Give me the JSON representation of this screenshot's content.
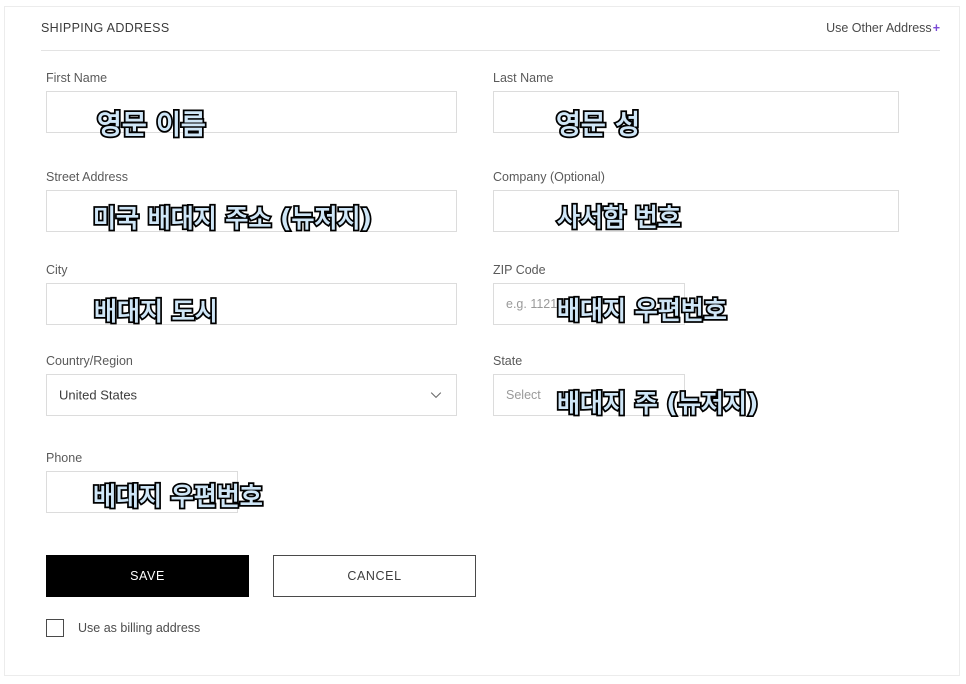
{
  "section": {
    "title": "SHIPPING ADDRESS",
    "use_other_address": "Use Other Address",
    "use_other_plus": "+",
    "accent_plus_color": "#7b4bd6"
  },
  "fields": {
    "first_name": {
      "label": "First Name",
      "value": "",
      "placeholder": ""
    },
    "last_name": {
      "label": "Last Name",
      "value": "",
      "placeholder": ""
    },
    "street": {
      "label": "Street Address",
      "value": "",
      "placeholder": ""
    },
    "company": {
      "label": "Company (Optional)",
      "value": "",
      "placeholder": ""
    },
    "city": {
      "label": "City",
      "value": "",
      "placeholder": ""
    },
    "zip": {
      "label": "ZIP Code",
      "value": "",
      "placeholder": "e.g. 11215"
    },
    "country": {
      "label": "Country/Region",
      "value": "United States",
      "placeholder": ""
    },
    "state": {
      "label": "State",
      "value": "",
      "placeholder": "Select"
    },
    "phone": {
      "label": "Phone",
      "value": "",
      "placeholder": ""
    }
  },
  "actions": {
    "save_label": "SAVE",
    "cancel_label": "CANCEL",
    "billing_checkbox_label": "Use as billing address"
  },
  "annotations": {
    "first_name": "영문 이름",
    "last_name": "영문 성",
    "street": "미국 배대지 주소 (뉴저지)",
    "company": "사서함 번호",
    "city": "배대지 도시",
    "zip": "배대지 우편번호",
    "state": "배대지 주 (뉴저지)",
    "phone": "배대지 우편번호",
    "fill_color": "#cfe6f7",
    "stroke_color": "#000000"
  }
}
